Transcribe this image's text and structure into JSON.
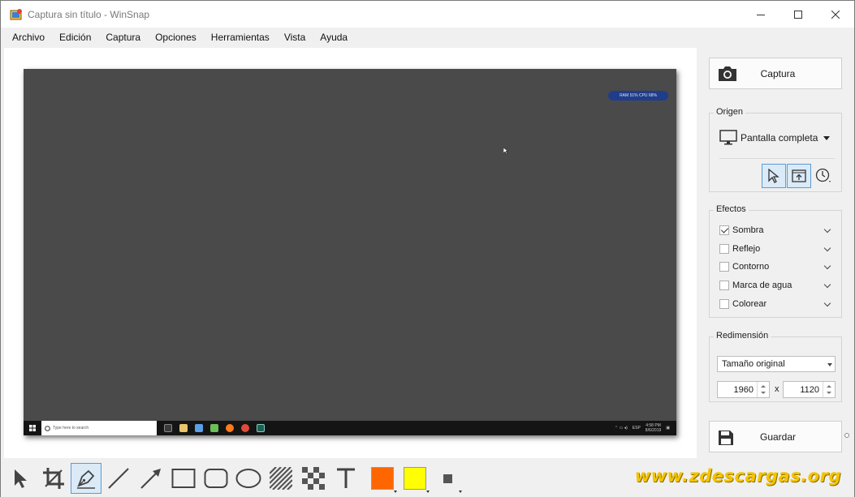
{
  "window": {
    "title": "Captura sin título - WinSnap",
    "minimize_icon": "minimize-icon",
    "maximize_icon": "maximize-icon",
    "close_icon": "close-icon"
  },
  "menu": [
    "Archivo",
    "Edición",
    "Captura",
    "Opciones",
    "Herramientas",
    "Vista",
    "Ayuda"
  ],
  "preview": {
    "perf_widget": "RAM 51% CPU 68%",
    "taskbar": {
      "search_placeholder": "Type here to search",
      "lang": "ESP",
      "time": "4:58 PM",
      "date": "8/6/2019"
    }
  },
  "panel": {
    "capture_label": "Captura",
    "origin": {
      "title": "Origen",
      "selected": "Pantalla completa"
    },
    "effects": {
      "title": "Efectos",
      "items": [
        {
          "label": "Sombra",
          "checked": true
        },
        {
          "label": "Reflejo",
          "checked": false
        },
        {
          "label": "Contorno",
          "checked": false
        },
        {
          "label": "Marca de agua",
          "checked": false
        },
        {
          "label": "Colorear",
          "checked": false
        }
      ]
    },
    "resize": {
      "title": "Redimensión",
      "selected": "Tamaño original",
      "width": "1960",
      "height": "1120",
      "times": "x"
    },
    "save_label": "Guardar"
  },
  "colors": {
    "primary": "#ff6600",
    "secondary": "#ffff00",
    "accent": "#5b9bd5",
    "canvas_bg": "#4a4a4a"
  },
  "watermark": "www.zdescargas.org"
}
